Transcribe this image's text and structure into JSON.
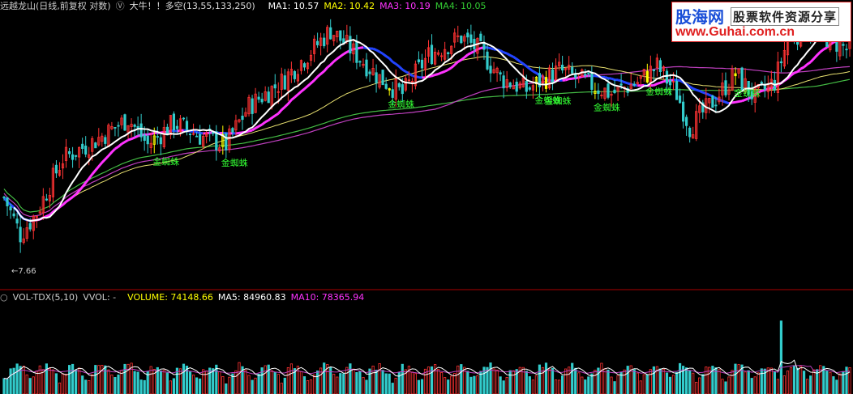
{
  "header": {
    "title": "远越龙山(日线,前复权 对数)",
    "indicator_icon": "circle-chevron-icon",
    "signal": "大牛！！多空(13,55,133,250)",
    "ma": [
      {
        "label": "MA1: 10.57",
        "color": "#ffffff"
      },
      {
        "label": "MA2: 10.42",
        "color": "#ffff00"
      },
      {
        "label": "MA3: 10.19",
        "color": "#ff33ff"
      },
      {
        "label": "MA4: 10.05",
        "color": "#33cc33"
      }
    ]
  },
  "volume_header": {
    "title": "VOL-TDX(5,10)",
    "vvol": "VVOL: -",
    "volume": "VOLUME: 74148.66",
    "ma5": "MA5: 84960.83",
    "ma10": "MA10: 78365.94",
    "colors": {
      "volume": "#ffff00",
      "ma5": "#ffffff",
      "ma10": "#ff33ff"
    }
  },
  "watermark": {
    "brand": "股海网",
    "slogan": "股票软件资源分享",
    "url": "www.Guhai.com.cn"
  },
  "chart_data": {
    "type": "candlestick",
    "low_label": "7.66",
    "signal_label": "金蜘蛛",
    "ylim_price": [
      7.4,
      13.2
    ],
    "colors": {
      "up": "#ff3333",
      "down": "#33cccc",
      "signal": "#ffff00",
      "ma_white": "#ffffff",
      "ma_yellow": "#e8e070",
      "ma_magenta": "#c040c0",
      "ma_green": "#44bb44",
      "trend_blue": "#2244ff",
      "trend_pink": "#ff33ff",
      "label": "#33ff33"
    },
    "candles": [],
    "signal_positions": [
      46,
      67,
      118,
      163,
      166,
      181,
      197,
      224
    ]
  }
}
